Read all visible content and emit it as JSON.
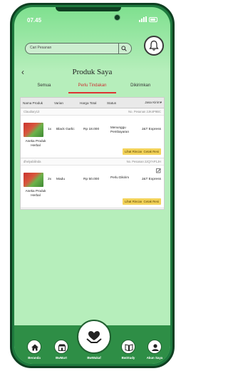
{
  "status_bar": {
    "time": "07.45"
  },
  "search": {
    "placeholder": "Cari Pesanan"
  },
  "header": {
    "back_glyph": "‹",
    "title": "Produk Saya"
  },
  "tabs": [
    {
      "label": "Semua",
      "active": false
    },
    {
      "label": "Perlu Tindakan",
      "active": true
    },
    {
      "label": "Dikirimkan",
      "active": false
    }
  ],
  "table": {
    "columns": [
      "Nama Produk",
      "Varian",
      "Harga Total",
      "Status",
      "Jasa Kirim"
    ],
    "sort_glyph": "▾"
  },
  "orders": [
    {
      "shop": "Claudiary13",
      "order_no": "No. Pesanan 2JK4P9BC",
      "product": "Aneka Produk Herbal",
      "qty": "1x",
      "variant": "Black Garlic",
      "price": "Rp 18.000",
      "status": "Menunggu Pembayaran",
      "courier": "J&T Express",
      "btn_detail": "Lihat Rincian",
      "btn_print": "Cetak Resi"
    },
    {
      "shop": "dhelyabilinda",
      "order_no": "No. Pesanan 2JQ7AP1JH",
      "product": "Aneka Produk Herbal",
      "qty": "2x",
      "variant": "Madu",
      "price": "Rp 50.000",
      "status": "Perlu Dikirim",
      "courier": "J&T Express",
      "btn_detail": "Lihat Rincian",
      "btn_print": "Cetak Resi"
    }
  ],
  "nav": {
    "items": [
      {
        "label": "Beranda",
        "icon": "home-icon"
      },
      {
        "label": "BwMart",
        "icon": "store-icon"
      },
      {
        "label": "BwWakaf",
        "icon": "heart-hands-icon"
      },
      {
        "label": "BwStudy",
        "icon": "book-icon"
      },
      {
        "label": "Akun Saya",
        "icon": "user-icon"
      }
    ]
  },
  "colors": {
    "nav_green": "#2e8e46",
    "screen_green": "#b6eebb",
    "active_tab": "#d33333",
    "action_button": "#f3d35a"
  }
}
